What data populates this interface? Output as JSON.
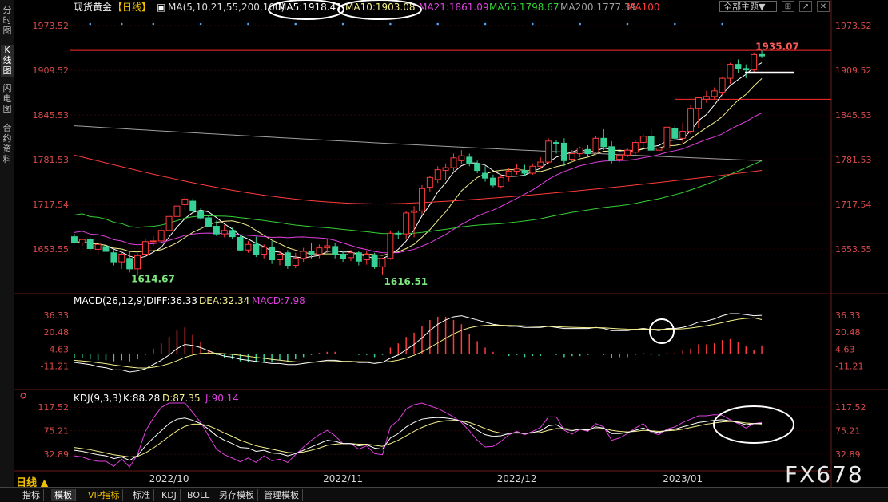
{
  "sidebar": {
    "tabs": [
      {
        "label": "分时图",
        "active": false
      },
      {
        "label": "K线图",
        "active": true
      },
      {
        "label": "闪电图",
        "active": false
      },
      {
        "label": "合约资料",
        "active": false
      }
    ]
  },
  "header": {
    "title": "现货黄金",
    "period_tag": "【日线】",
    "ma_label": "MA(5,10,21,55,200,100)",
    "ma_values": [
      {
        "label": "MA5:1918.41",
        "color": "#ffffff"
      },
      {
        "label": "MA10:1903.08",
        "color": "#f5f08c"
      },
      {
        "label": "MA21:1861.09",
        "color": "#e040e0"
      },
      {
        "label": "MA55:1798.67",
        "color": "#36d136"
      },
      {
        "label": "MA200:1777.39",
        "color": "#a0a0a0"
      },
      {
        "label": "MA100",
        "color": "#ff3b3b"
      }
    ],
    "theme_button": "全部主题▼",
    "window_buttons": [
      "⊞",
      "↗",
      "✕"
    ]
  },
  "colors": {
    "up": "#ff3b3b",
    "down": "#36d196",
    "grid": "#5a1010",
    "axis_text": "#d84a4a"
  },
  "chart_data": [
    {
      "type": "candlestick",
      "title": "现货黄金 日线",
      "y_ticks": [
        1973.52,
        1909.52,
        1845.53,
        1781.53,
        1717.54,
        1653.55
      ],
      "ylim": [
        1610,
        1985
      ],
      "x_ticks": [
        {
          "label": "2022/10",
          "index": 12
        },
        {
          "label": "2022/11",
          "index": 34
        },
        {
          "label": "2022/12",
          "index": 56
        },
        {
          "label": "2023/01",
          "index": 77
        }
      ],
      "candles": [
        [
          1671,
          1675,
          1662,
          1662
        ],
        [
          1662,
          1667,
          1658,
          1667
        ],
        [
          1667,
          1670,
          1650,
          1654
        ],
        [
          1653,
          1662,
          1645,
          1660
        ],
        [
          1657,
          1660,
          1640,
          1650
        ],
        [
          1648,
          1652,
          1630,
          1635
        ],
        [
          1635,
          1650,
          1625,
          1646
        ],
        [
          1640,
          1650,
          1620,
          1625
        ],
        [
          1625,
          1647,
          1615,
          1644
        ],
        [
          1646,
          1668,
          1645,
          1664
        ],
        [
          1664,
          1672,
          1658,
          1665
        ],
        [
          1665,
          1685,
          1663,
          1680
        ],
        [
          1680,
          1705,
          1678,
          1700
        ],
        [
          1700,
          1722,
          1695,
          1715
        ],
        [
          1717,
          1728,
          1710,
          1725
        ],
        [
          1722,
          1726,
          1705,
          1708
        ],
        [
          1708,
          1712,
          1695,
          1698
        ],
        [
          1698,
          1702,
          1685,
          1686
        ],
        [
          1686,
          1694,
          1672,
          1675
        ],
        [
          1675,
          1688,
          1670,
          1680
        ],
        [
          1680,
          1684,
          1668,
          1671
        ],
        [
          1670,
          1674,
          1650,
          1652
        ],
        [
          1652,
          1665,
          1648,
          1660
        ],
        [
          1660,
          1671,
          1642,
          1645
        ],
        [
          1646,
          1660,
          1640,
          1656
        ],
        [
          1656,
          1665,
          1632,
          1638
        ],
        [
          1638,
          1651,
          1630,
          1646
        ],
        [
          1648,
          1652,
          1625,
          1630
        ],
        [
          1630,
          1648,
          1626,
          1640
        ],
        [
          1640,
          1655,
          1635,
          1650
        ],
        [
          1650,
          1662,
          1640,
          1646
        ],
        [
          1646,
          1660,
          1640,
          1655
        ],
        [
          1655,
          1668,
          1648,
          1658
        ],
        [
          1657,
          1662,
          1640,
          1646
        ],
        [
          1646,
          1650,
          1635,
          1640
        ],
        [
          1641,
          1652,
          1636,
          1648
        ],
        [
          1648,
          1650,
          1630,
          1636
        ],
        [
          1638,
          1650,
          1631,
          1646
        ],
        [
          1644,
          1648,
          1625,
          1628
        ],
        [
          1628,
          1641,
          1616,
          1640
        ],
        [
          1640,
          1680,
          1638,
          1676
        ],
        [
          1676,
          1680,
          1668,
          1675
        ],
        [
          1675,
          1708,
          1668,
          1705
        ],
        [
          1706,
          1715,
          1670,
          1708
        ],
        [
          1708,
          1745,
          1703,
          1740
        ],
        [
          1742,
          1758,
          1736,
          1756
        ],
        [
          1753,
          1772,
          1748,
          1767
        ],
        [
          1766,
          1776,
          1752,
          1770
        ],
        [
          1770,
          1790,
          1765,
          1784
        ],
        [
          1780,
          1795,
          1775,
          1787
        ],
        [
          1785,
          1790,
          1772,
          1776
        ],
        [
          1776,
          1780,
          1762,
          1766
        ],
        [
          1762,
          1772,
          1750,
          1755
        ],
        [
          1755,
          1760,
          1742,
          1745
        ],
        [
          1743,
          1760,
          1740,
          1756
        ],
        [
          1757,
          1770,
          1750,
          1765
        ],
        [
          1765,
          1775,
          1760,
          1768
        ],
        [
          1766,
          1774,
          1758,
          1762
        ],
        [
          1762,
          1776,
          1760,
          1772
        ],
        [
          1772,
          1785,
          1768,
          1778
        ],
        [
          1778,
          1812,
          1775,
          1808
        ],
        [
          1806,
          1810,
          1790,
          1805
        ],
        [
          1805,
          1812,
          1772,
          1780
        ],
        [
          1782,
          1795,
          1778,
          1790
        ],
        [
          1790,
          1800,
          1785,
          1798
        ],
        [
          1796,
          1802,
          1786,
          1790
        ],
        [
          1792,
          1815,
          1788,
          1812
        ],
        [
          1812,
          1825,
          1795,
          1800
        ],
        [
          1800,
          1808,
          1776,
          1780
        ],
        [
          1782,
          1790,
          1778,
          1788
        ],
        [
          1788,
          1798,
          1785,
          1795
        ],
        [
          1792,
          1810,
          1788,
          1806
        ],
        [
          1806,
          1818,
          1798,
          1815
        ],
        [
          1815,
          1825,
          1800,
          1795
        ],
        [
          1795,
          1802,
          1785,
          1798
        ],
        [
          1798,
          1832,
          1795,
          1828
        ],
        [
          1826,
          1830,
          1808,
          1812
        ],
        [
          1812,
          1835,
          1805,
          1822
        ],
        [
          1822,
          1860,
          1818,
          1855
        ],
        [
          1855,
          1872,
          1826,
          1870
        ],
        [
          1868,
          1880,
          1863,
          1872
        ],
        [
          1872,
          1885,
          1868,
          1880
        ],
        [
          1878,
          1900,
          1874,
          1898
        ],
        [
          1898,
          1920,
          1890,
          1918
        ],
        [
          1918,
          1925,
          1905,
          1912
        ],
        [
          1912,
          1918,
          1898,
          1910
        ],
        [
          1910,
          1935,
          1905,
          1932
        ],
        [
          1932,
          1938,
          1927,
          1930
        ]
      ],
      "annotations": [
        {
          "label": "1614.67",
          "index": 7
        },
        {
          "label": "1616.51",
          "index": 39
        },
        {
          "label": "1935.07",
          "index": 86
        }
      ]
    },
    {
      "type": "bar",
      "title": "MACD(26,12,9)",
      "legend": [
        {
          "label": "MACD(26,12,9)",
          "color": "#ffffff"
        },
        {
          "label": "DIFF:36.33",
          "color": "#ffffff"
        },
        {
          "label": "DEA:32.34",
          "color": "#f5f08c"
        },
        {
          "label": "MACD:7.98",
          "color": "#e040e0"
        }
      ],
      "y_ticks": [
        36.33,
        20.48,
        4.63,
        -11.21
      ],
      "ylim": [
        -20,
        44
      ],
      "diff": [
        -8,
        -9,
        -10,
        -12,
        -13,
        -15,
        -15,
        -17,
        -16,
        -14,
        -10,
        -6,
        -1,
        5,
        9,
        8,
        6,
        3,
        0,
        -2,
        -3,
        -5,
        -6,
        -7,
        -8,
        -9,
        -9,
        -10,
        -10,
        -9,
        -8,
        -7,
        -6,
        -6,
        -7,
        -7,
        -8,
        -8,
        -9,
        -8,
        -4,
        -1,
        4,
        9,
        15,
        22,
        28,
        32,
        35,
        36,
        34,
        32,
        30,
        28,
        27,
        26,
        26,
        25,
        25,
        25,
        26,
        25,
        24,
        24,
        24,
        24,
        25,
        24,
        22,
        22,
        22,
        23,
        24,
        23,
        22,
        24,
        24,
        25,
        27,
        30,
        31,
        33,
        36,
        38,
        38,
        37,
        36,
        36.33
      ],
      "dea": [
        -6,
        -6.6,
        -7.3,
        -8.2,
        -9.2,
        -10.4,
        -11.3,
        -12.4,
        -13.1,
        -13.3,
        -12.6,
        -11.3,
        -9.2,
        -6.4,
        -3.3,
        -1,
        0.4,
        0.9,
        0.7,
        0.2,
        -0.4,
        -1.3,
        -2.2,
        -3.2,
        -4.1,
        -5.1,
        -5.9,
        -6.7,
        -7.4,
        -7.7,
        -7.8,
        -7.6,
        -7.3,
        -7.1,
        -7.1,
        -7.1,
        -7.3,
        -7.4,
        -7.7,
        -7.8,
        -7.1,
        -5.9,
        -3.9,
        -1.3,
        2,
        6,
        10.4,
        14.7,
        18.8,
        22.2,
        24.6,
        26.1,
        26.9,
        27.1,
        27.1,
        26.9,
        26.7,
        26.4,
        26.1,
        25.9,
        25.9,
        25.7,
        25.4,
        25.1,
        24.9,
        24.7,
        24.8,
        24.6,
        24.1,
        23.7,
        23.4,
        23.3,
        23.4,
        23.3,
        23.1,
        23.3,
        23.4,
        23.7,
        24.4,
        25.5,
        26.6,
        27.9,
        29.5,
        31.2,
        32.6,
        33.5,
        34,
        32.34
      ],
      "hist": [
        -4,
        -4,
        -5,
        -6,
        -6,
        -7,
        -6,
        -7,
        -5,
        -1,
        5,
        10,
        16,
        22,
        25,
        18,
        11,
        4,
        -1,
        -4,
        -5,
        -7,
        -8,
        -8,
        -8,
        -8,
        -6,
        -7,
        -5,
        -3,
        -1,
        1,
        2,
        2,
        0,
        0,
        -1,
        -1,
        -3,
        -1,
        6,
        10,
        16,
        20,
        26,
        32,
        35,
        35,
        32,
        28,
        19,
        12,
        6,
        2,
        0,
        -2,
        -1,
        -3,
        -2,
        -2,
        0,
        -1,
        -3,
        -2,
        -2,
        -1,
        0,
        -1,
        -4,
        -3,
        -3,
        -1,
        1,
        -1,
        -2,
        1,
        1,
        3,
        5,
        9,
        9,
        10,
        13,
        14,
        11,
        7,
        4,
        7.98
      ]
    },
    {
      "type": "line",
      "title": "KDJ(9,3,3)",
      "legend": [
        {
          "label": "KDJ(9,3,3)",
          "color": "#ffffff"
        },
        {
          "label": "K:88.28",
          "color": "#ffffff"
        },
        {
          "label": "D:87.35",
          "color": "#f5f08c"
        },
        {
          "label": "J:90.14",
          "color": "#e040e0"
        }
      ],
      "y_ticks": [
        117.52,
        75.21,
        32.89
      ],
      "ylim": [
        10,
        125
      ],
      "k": [
        40,
        38,
        35,
        32,
        30,
        25,
        28,
        22,
        30,
        48,
        62,
        75,
        88,
        96,
        98,
        94,
        88,
        78,
        66,
        58,
        52,
        45,
        44,
        38,
        40,
        35,
        34,
        30,
        34,
        40,
        46,
        52,
        58,
        56,
        52,
        52,
        48,
        50,
        44,
        42,
        62,
        70,
        82,
        90,
        96,
        98,
        99,
        98,
        96,
        92,
        85,
        76,
        68,
        65,
        66,
        70,
        72,
        70,
        72,
        75,
        84,
        86,
        78,
        75,
        78,
        76,
        82,
        80,
        70,
        70,
        72,
        76,
        80,
        74,
        72,
        76,
        78,
        82,
        86,
        90,
        92,
        94,
        95,
        93,
        90,
        86,
        88,
        88.28
      ],
      "d": [
        45,
        43,
        41,
        38,
        35,
        32,
        30,
        28,
        29,
        35,
        44,
        54,
        65,
        75,
        83,
        87,
        87,
        84,
        78,
        71,
        65,
        58,
        53,
        48,
        45,
        42,
        39,
        36,
        35,
        37,
        40,
        44,
        49,
        51,
        52,
        52,
        51,
        51,
        49,
        47,
        52,
        58,
        66,
        74,
        81,
        87,
        91,
        93,
        94,
        93,
        90,
        85,
        79,
        74,
        71,
        71,
        71,
        71,
        71,
        72,
        76,
        79,
        79,
        78,
        78,
        77,
        79,
        79,
        76,
        74,
        73,
        74,
        76,
        75,
        74,
        75,
        76,
        78,
        81,
        84,
        87,
        89,
        91,
        92,
        91,
        89,
        88,
        87.35
      ],
      "j": [
        30,
        28,
        23,
        20,
        20,
        11,
        24,
        10,
        32,
        74,
        98,
        117,
        125,
        125,
        125,
        108,
        90,
        66,
        42,
        32,
        26,
        19,
        26,
        18,
        30,
        21,
        24,
        18,
        32,
        46,
        58,
        68,
        76,
        66,
        52,
        52,
        42,
        48,
        34,
        32,
        82,
        94,
        114,
        122,
        125,
        120,
        115,
        108,
        100,
        90,
        75,
        58,
        46,
        47,
        56,
        68,
        74,
        68,
        74,
        81,
        100,
        100,
        76,
        69,
        78,
        74,
        88,
        82,
        58,
        62,
        70,
        80,
        88,
        72,
        68,
        78,
        82,
        90,
        96,
        102,
        102,
        104,
        103,
        95,
        88,
        80,
        88,
        90.14
      ]
    }
  ],
  "footer": {
    "period": "日线 ▲",
    "tabs": [
      "指标",
      "模板",
      "VIP指标",
      "标准",
      "KDJ",
      "BOLL",
      "另存模板",
      "管理模板"
    ],
    "active_tab": 1
  },
  "watermark": "FX678"
}
